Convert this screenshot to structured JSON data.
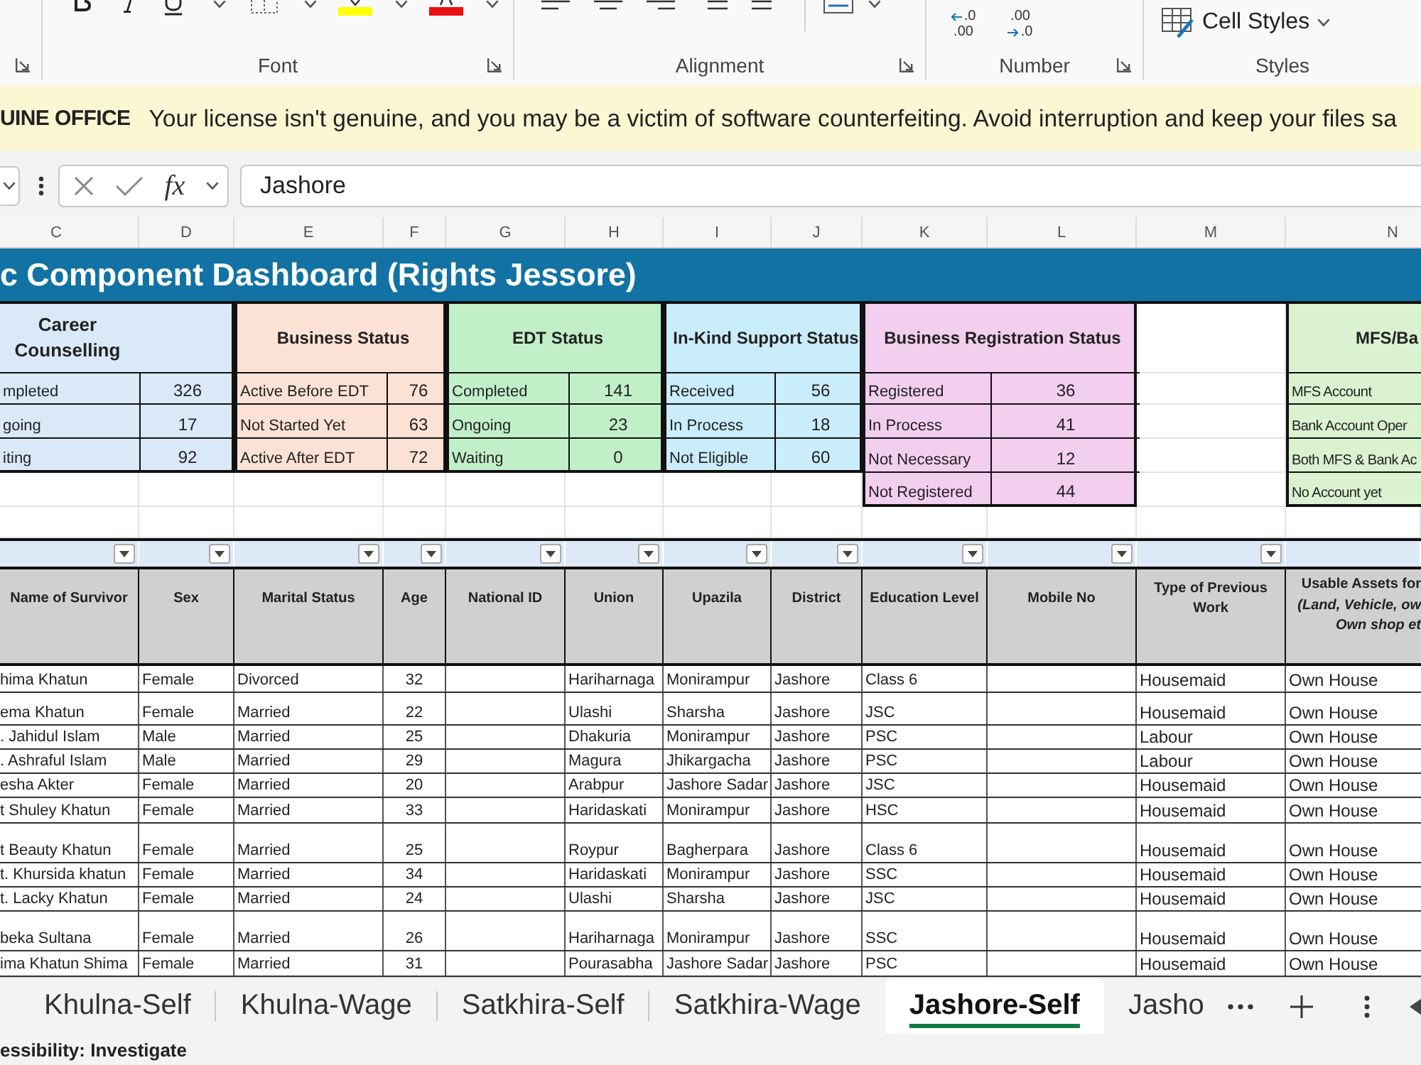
{
  "ribbon": {
    "groups": [
      {
        "kind": "cut",
        "launcher": true
      },
      {
        "kind": "font",
        "label": "Font",
        "launcher": true
      },
      {
        "kind": "alignment",
        "label": "Alignment",
        "launcher": true
      },
      {
        "kind": "number",
        "label": "Number",
        "launcher": true,
        "buttons": [
          {
            "kind": "increase",
            "lines": [
              ".0",
              ".00"
            ]
          },
          {
            "kind": "decrease",
            "lines": [
              ".00",
              ".0"
            ]
          }
        ]
      },
      {
        "kind": "styles",
        "label": "Styles",
        "button": "Cell Styles"
      }
    ]
  },
  "banner": {
    "title": "UINE OFFICE",
    "message": "Your license isn't genuine, and you may be a victim of software counterfeiting. Avoid interruption and keep your files sa"
  },
  "formula_bar": {
    "function_label": "fx",
    "value": "Jashore"
  },
  "column_letters": [
    "C",
    "D",
    "E",
    "F",
    "G",
    "H",
    "I",
    "J",
    "K",
    "L",
    "M",
    "N"
  ],
  "title": "c Component Dashboard (Rights Jessore)",
  "status_tables": [
    {
      "title": "Career Counselling",
      "color": "#dae9f8",
      "rows": [
        {
          "label": "mpleted",
          "value": "326"
        },
        {
          "label": "going",
          "value": "17"
        },
        {
          "label": "iting",
          "value": "92"
        }
      ]
    },
    {
      "title": "Business Status",
      "color": "#fbe2d5",
      "rows": [
        {
          "label": "Active Before EDT",
          "value": "76"
        },
        {
          "label": "Not Started Yet",
          "value": "63"
        },
        {
          "label": "Active After EDT",
          "value": "72"
        }
      ]
    },
    {
      "title": "EDT Status",
      "color": "#c1f0c8",
      "rows": [
        {
          "label": "Completed",
          "value": "141"
        },
        {
          "label": "Ongoing",
          "value": "23"
        },
        {
          "label": "Waiting",
          "value": "0"
        }
      ]
    },
    {
      "title": "In-Kind Support Status",
      "color": "#caedfb",
      "rows": [
        {
          "label": "Received",
          "value": "56"
        },
        {
          "label": "In Process",
          "value": "18"
        },
        {
          "label": "Not Eligible",
          "value": "60"
        }
      ]
    },
    {
      "title": "Business Registration Status",
      "color": "#f2ceef",
      "rows": [
        {
          "label": "Registered",
          "value": "36"
        },
        {
          "label": "In Process",
          "value": "41"
        },
        {
          "label": "Not Necessary",
          "value": "12"
        },
        {
          "label": "Not Registered",
          "value": "44"
        }
      ]
    },
    {
      "title": "MFS/Ba",
      "color": "#daf2d0",
      "rows": [
        {
          "label": "MFS Account"
        },
        {
          "label": "Bank Account Oper"
        },
        {
          "label": "Both MFS & Bank Ac"
        },
        {
          "label": "No Account yet"
        }
      ]
    }
  ],
  "table": {
    "columns": [
      {
        "label": "Name of Survivor",
        "filter": true
      },
      {
        "label": "Sex",
        "filter": true
      },
      {
        "label": "Marital Status",
        "filter": true
      },
      {
        "label": "Age",
        "filter": true
      },
      {
        "label": "National ID",
        "filter": true
      },
      {
        "label": "Union",
        "filter": true
      },
      {
        "label": "Upazila",
        "filter": true
      },
      {
        "label": "District",
        "filter": true
      },
      {
        "label": "Education Level",
        "filter": true
      },
      {
        "label": "Mobile No",
        "filter": true
      },
      {
        "label": "Type of Previous Work",
        "filter": true
      },
      {
        "label": "Usable Assets for *(Land, Vehicle, ow Own shop et*",
        "filter": false
      }
    ],
    "rows": [
      {
        "name": "hima Khatun",
        "sex": "Female",
        "marital_status": "Divorced",
        "age": "32",
        "union": "Hariharnaga",
        "upazila": "Monirampur",
        "district": "Jashore",
        "education_level": "Class 6",
        "type_of_previous_work": "Housemaid",
        "usable_assets": "Own House"
      },
      {
        "name": "ema Khatun",
        "sex": "Female",
        "marital_status": "Married",
        "age": "22",
        "union": "Ulashi",
        "upazila": "Sharsha",
        "district": "Jashore",
        "education_level": "JSC",
        "type_of_previous_work": "Housemaid",
        "usable_assets": "Own House"
      },
      {
        "name": ". Jahidul Islam",
        "sex": "Male",
        "marital_status": "Married",
        "age": "25",
        "union": "Dhakuria",
        "upazila": "Monirampur",
        "district": "Jashore",
        "education_level": "PSC",
        "type_of_previous_work": "Labour",
        "usable_assets": "Own House"
      },
      {
        "name": ". Ashraful Islam",
        "sex": "Male",
        "marital_status": "Married",
        "age": "29",
        "union": "Magura",
        "upazila": "Jhikargacha",
        "district": "Jashore",
        "education_level": "PSC",
        "type_of_previous_work": "Labour",
        "usable_assets": "Own House"
      },
      {
        "name": "esha Akter",
        "sex": "Female",
        "marital_status": "Married",
        "age": "20",
        "union": "Arabpur",
        "upazila": "Jashore Sadar",
        "district": "Jashore",
        "education_level": "JSC",
        "type_of_previous_work": "Housemaid",
        "usable_assets": "Own House"
      },
      {
        "name": "t Shuley Khatun",
        "sex": "Female",
        "marital_status": "Married",
        "age": "33",
        "union": "Haridaskati",
        "upazila": "Monirampur",
        "district": "Jashore",
        "education_level": "HSC",
        "type_of_previous_work": "Housemaid",
        "usable_assets": "Own House"
      },
      {
        "name": "t Beauty Khatun",
        "sex": "Female",
        "marital_status": "Married",
        "age": "25",
        "union": "Roypur",
        "upazila": "Bagherpara",
        "district": "Jashore",
        "education_level": "Class 6",
        "type_of_previous_work": "Housemaid",
        "usable_assets": "Own House"
      },
      {
        "name": "t. Khursida khatun",
        "sex": "Female",
        "marital_status": "Married",
        "age": "34",
        "union": "Haridaskati",
        "upazila": "Monirampur",
        "district": "Jashore",
        "education_level": "SSC",
        "type_of_previous_work": "Housemaid",
        "usable_assets": "Own House"
      },
      {
        "name": "t. Lacky Khatun",
        "sex": "Female",
        "marital_status": "Married",
        "age": "24",
        "union": "Ulashi",
        "upazila": "Sharsha",
        "district": "Jashore",
        "education_level": "JSC",
        "type_of_previous_work": "Housemaid",
        "usable_assets": "Own House"
      },
      {
        "name": "beka Sultana",
        "sex": "Female",
        "marital_status": "Married",
        "age": "26",
        "union": "Hariharnaga",
        "upazila": "Monirampur",
        "district": "Jashore",
        "education_level": "SSC",
        "type_of_previous_work": "Housemaid",
        "usable_assets": "Own House"
      },
      {
        "name": "ima Khatun Shima",
        "sex": "Female",
        "marital_status": "Married",
        "age": "31",
        "union": "Pourasabha",
        "upazila": "Jashore Sadar",
        "district": "Jashore",
        "education_level": "PSC",
        "type_of_previous_work": "Housemaid",
        "usable_assets": "Own House"
      }
    ]
  },
  "sheet_tabs": [
    {
      "label": "Khulna-Self",
      "selected": false
    },
    {
      "label": "Khulna-Wage",
      "selected": false
    },
    {
      "label": "Satkhira-Self",
      "selected": false
    },
    {
      "label": "Satkhira-Wage",
      "selected": false
    },
    {
      "label": "Jashore-Self",
      "selected": true
    },
    {
      "label": "Jasho",
      "selected": false
    }
  ],
  "status_bar": {
    "text": "essibility: Investigate"
  }
}
